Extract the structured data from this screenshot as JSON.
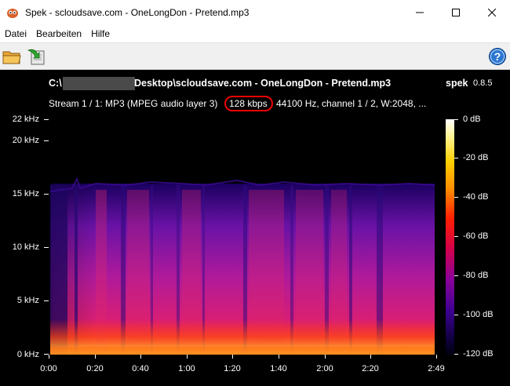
{
  "window": {
    "title": "Spek - scloudsave.com - OneLongDon - Pretend.mp3",
    "controls": [
      "minimize",
      "maximize",
      "close"
    ]
  },
  "menu": {
    "items": [
      "Datei",
      "Bearbeiten",
      "Hilfe"
    ]
  },
  "toolbar": {
    "buttons": [
      "open-file-icon",
      "save-icon",
      "help-icon"
    ]
  },
  "header": {
    "path_prefix": "C:\\",
    "path_rest": "Desktop\\scloudsave.com - OneLongDon - Pretend.mp3",
    "app_name": "spek",
    "app_version": "0.8.5",
    "stream_prefix": "Stream 1 / 1: MP3 (MPEG audio layer 3)",
    "stream_bitrate": "128 kbps",
    "stream_suffix": "44100 Hz, channel 1 / 2, W:2048, ..."
  },
  "axes": {
    "y_labels": [
      "22 kHz",
      "20 kHz",
      "15 kHz",
      "10 kHz",
      "5 kHz",
      "0 kHz"
    ],
    "x_labels": [
      "0:00",
      "0:20",
      "0:40",
      "1:00",
      "1:20",
      "1:40",
      "2:00",
      "2:20",
      "2:49"
    ],
    "db_labels": [
      "0 dB",
      "-20 dB",
      "-40 dB",
      "-60 dB",
      "-80 dB",
      "-100 dB",
      "-120 dB"
    ]
  },
  "spectrogram": {
    "duration": "2:49",
    "max_frequency_khz": 22,
    "cutoff_frequency_khz": 16,
    "colors": [
      "#ffffff",
      "#ffd000",
      "#ff2000",
      "#d4004a",
      "#8a009a",
      "#3a0090",
      "#000010"
    ]
  }
}
